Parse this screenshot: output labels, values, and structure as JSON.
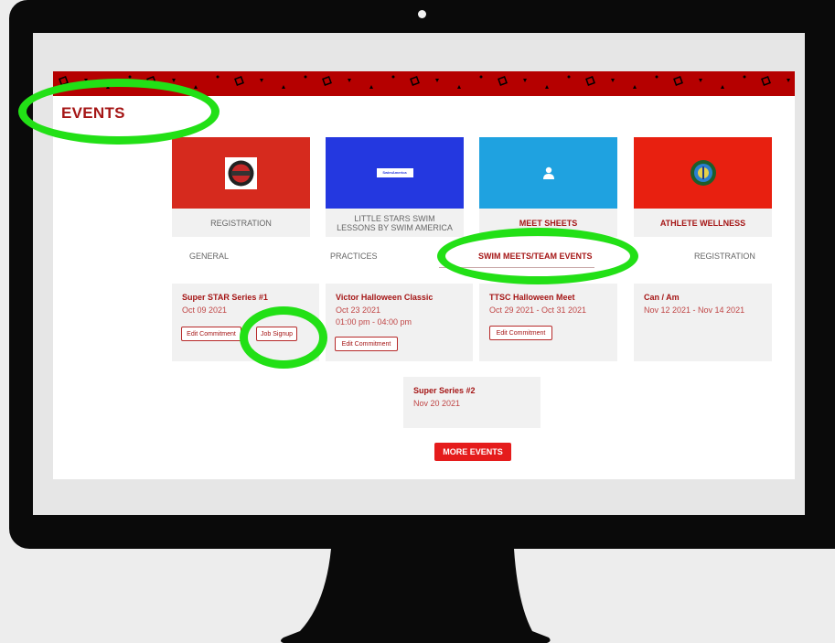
{
  "header": {
    "title": "EVENTS"
  },
  "cards": [
    {
      "label": "REGISTRATION",
      "bg": "#d62a1e",
      "icon": "star-logo-icon"
    },
    {
      "label": "LITTLE STARS SWIM LESSONS BY SWIM AMERICA",
      "bg": "#2438e0",
      "icon": "swim-america-logo-icon",
      "logo_text": "SwimAmerica"
    },
    {
      "label": "MEET SHEETS",
      "bg": "#1fa2e0",
      "icon": "person-icon"
    },
    {
      "label": "ATHLETE WELLNESS",
      "bg": "#e82010",
      "icon": "wellness-seal-icon"
    }
  ],
  "categories": [
    {
      "label": "GENERAL",
      "active": false
    },
    {
      "label": "PRACTICES",
      "active": false
    },
    {
      "label": "SWIM MEETS/TEAM EVENTS",
      "active": true
    },
    {
      "label": "REGISTRATION",
      "active": false
    }
  ],
  "events": [
    {
      "title": "Super STAR Series #1",
      "date": "Oct 09 2021",
      "buttons": [
        "Edit Commitment",
        "Job Signup"
      ]
    },
    {
      "title": "Victor Halloween Classic",
      "date": "Oct 23 2021",
      "time": "01:00 pm  - 04:00 pm",
      "buttons": [
        "Edit Commitment"
      ]
    },
    {
      "title": "TTSC Halloween Meet",
      "date": "Oct 29 2021  -  Oct 31 2021",
      "buttons": [
        "Edit Commitment"
      ]
    },
    {
      "title": "Can / Am",
      "date": "Nov 12 2021  -  Nov 14 2021"
    },
    {
      "title": "Super Series #2",
      "date": "Nov 20 2021"
    }
  ],
  "more_events_label": "MORE EVENTS",
  "colors": {
    "accent": "#a51616",
    "button_red": "#e51c1c",
    "highlight_ring": "#22e016",
    "banner": "#b50000"
  }
}
